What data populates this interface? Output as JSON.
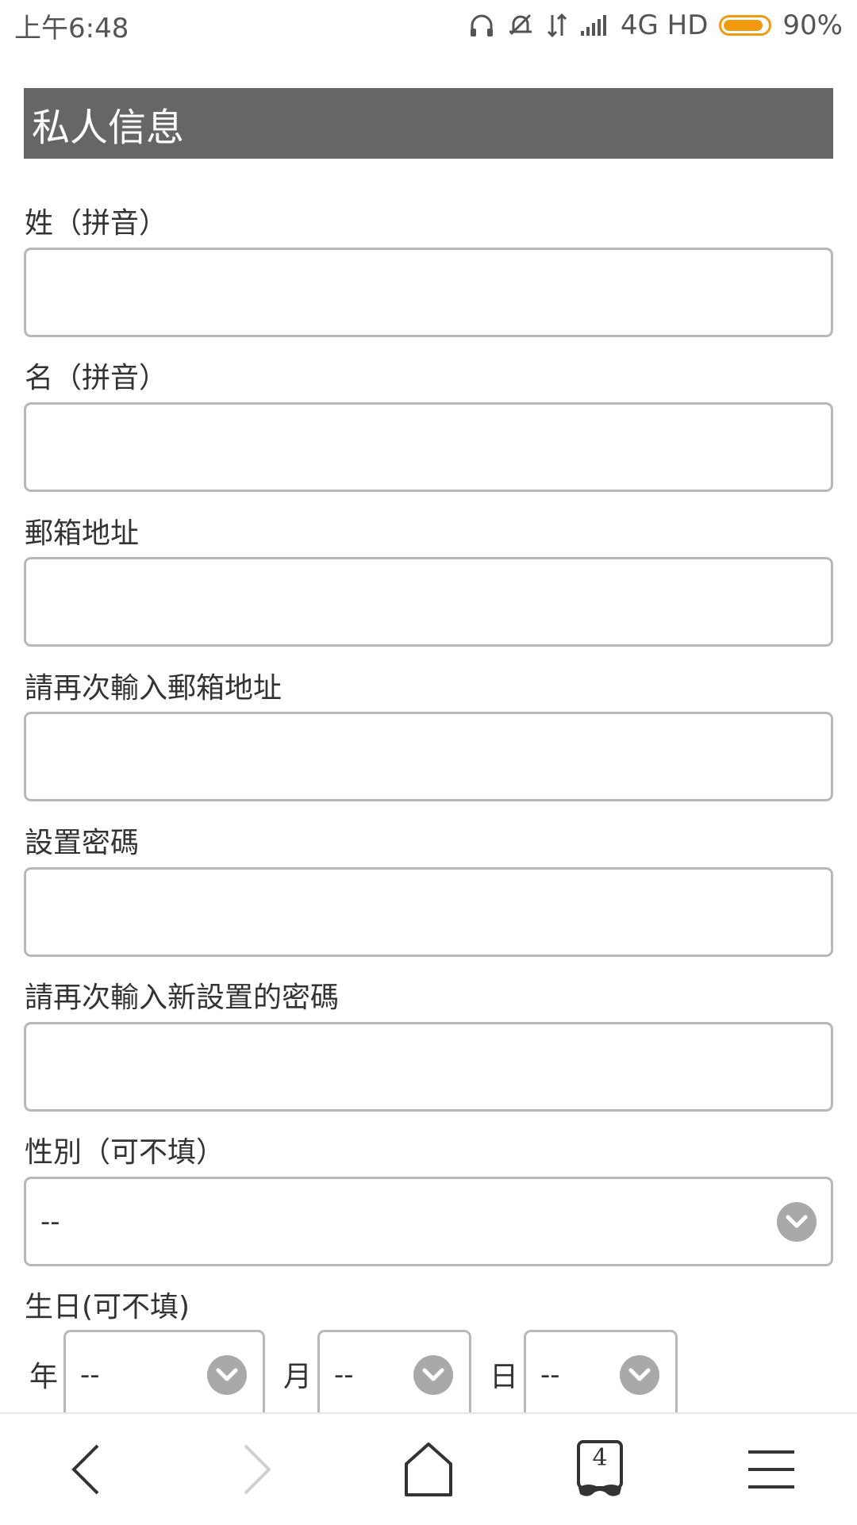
{
  "status_bar": {
    "time": "上午6:48",
    "network": "4G HD",
    "battery_percent": "90%",
    "battery_level": 0.9
  },
  "form": {
    "section_title": "私人信息",
    "fields": [
      {
        "label": "姓（拼音）",
        "value": ""
      },
      {
        "label": "名（拼音）",
        "value": ""
      },
      {
        "label": "郵箱地址",
        "value": ""
      },
      {
        "label": "請再次輸入郵箱地址",
        "value": ""
      },
      {
        "label": "設置密碼",
        "value": ""
      },
      {
        "label": "請再次輸入新設置的密碼",
        "value": ""
      }
    ],
    "gender": {
      "label": "性別（可不填）",
      "value": "--"
    },
    "birthday": {
      "label": "生日(可不填)",
      "year_label": "年",
      "year_value": "--",
      "month_label": "月",
      "month_value": "--",
      "day_label": "日",
      "day_value": "--"
    }
  },
  "browser_nav": {
    "tab_count": "4",
    "icons": [
      "back-icon",
      "forward-icon",
      "home-icon",
      "tabs-icon",
      "menu-icon"
    ]
  },
  "colors": {
    "header_bg": "#666666",
    "battery": "#f29a0f",
    "border": "#b8b8b8"
  }
}
